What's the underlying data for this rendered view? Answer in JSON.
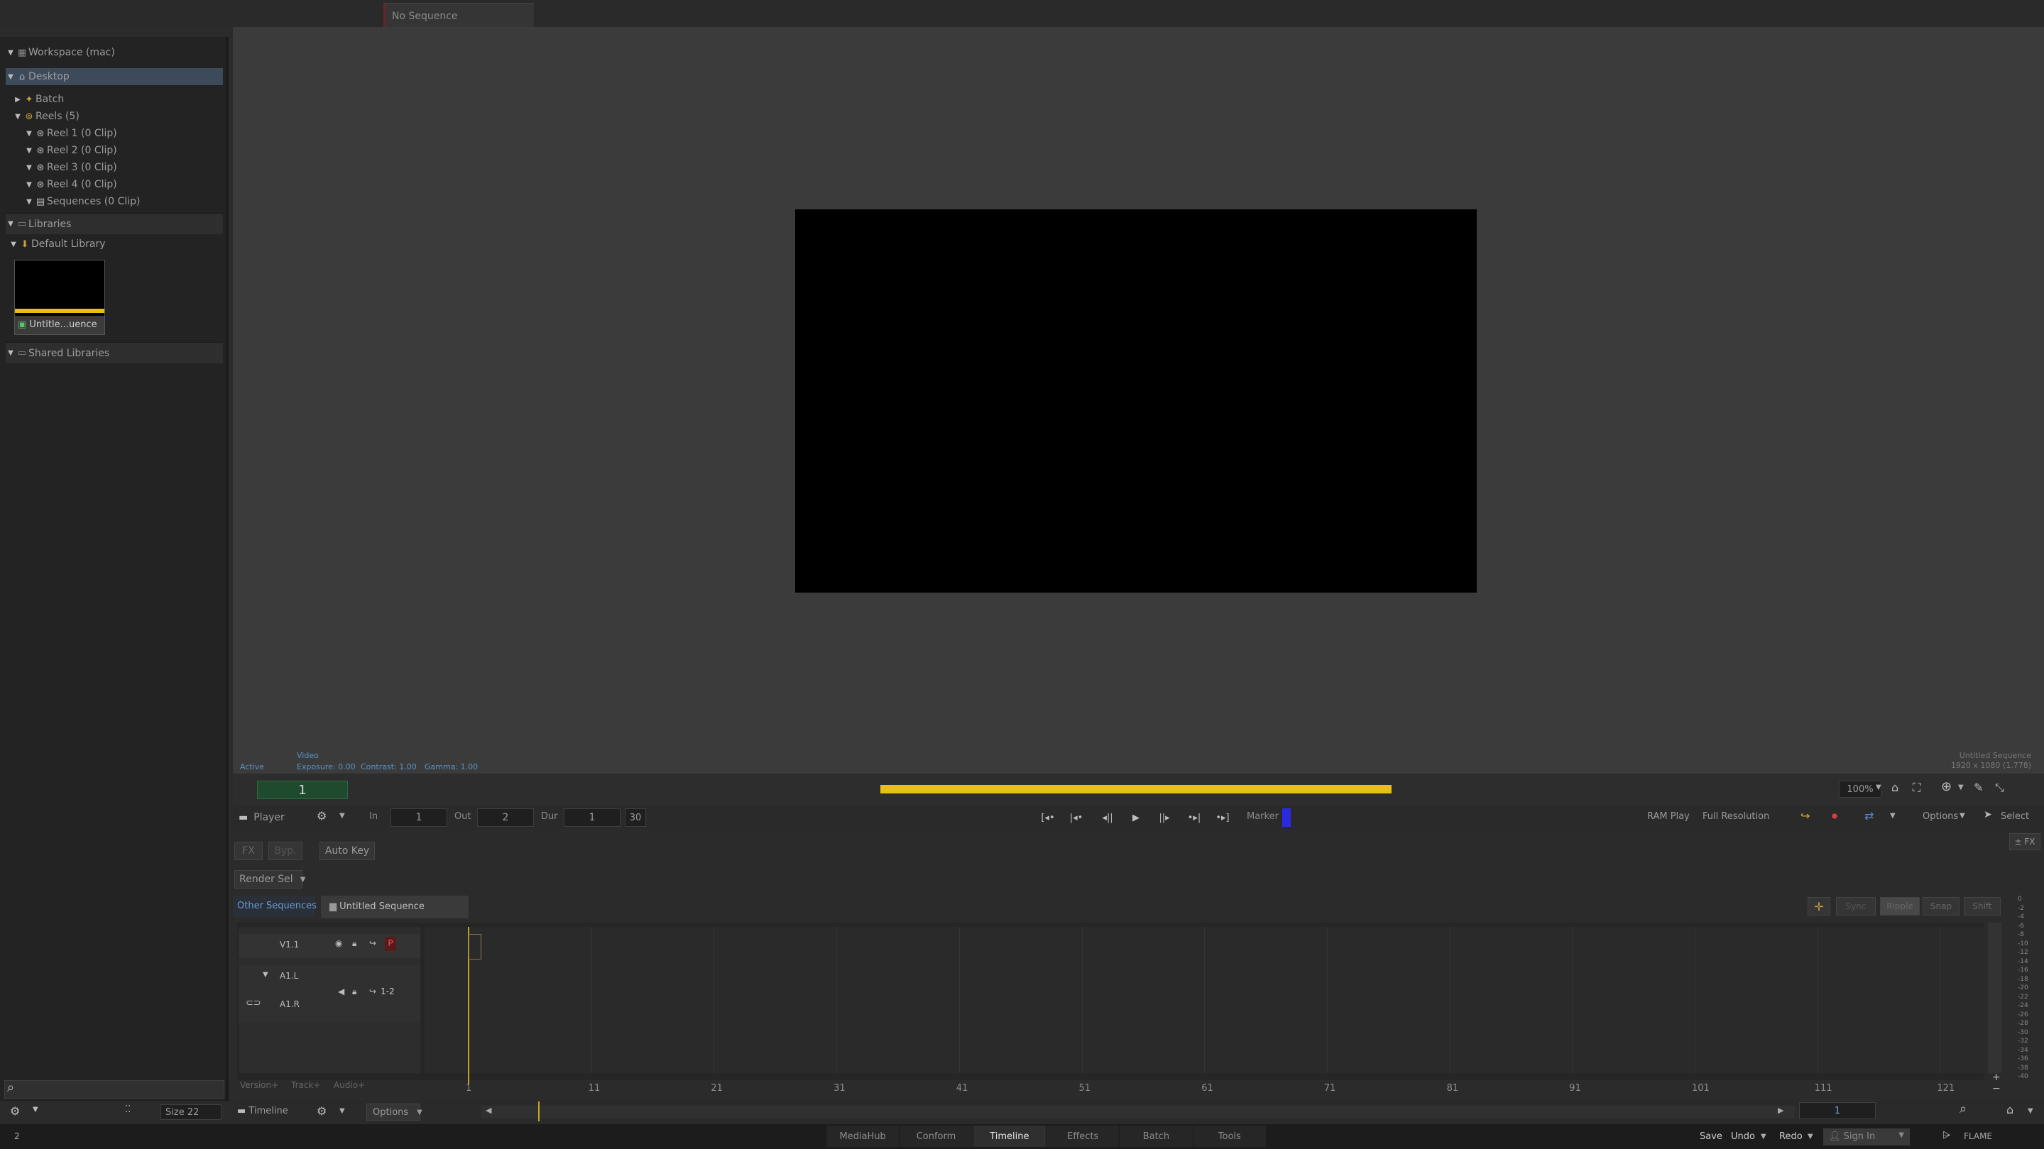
{
  "window": {
    "tab_label": "No Sequence"
  },
  "sidebar": {
    "workspace": "Workspace (mac)",
    "desktop": "Desktop",
    "batch": "Batch",
    "reels": "Reels (5)",
    "reel_items": [
      "Reel 1 (0 Clip)",
      "Reel 2 (0 Clip)",
      "Reel 3 (0 Clip)",
      "Reel 4 (0 Clip)",
      "Sequences (0 Clip)"
    ],
    "libraries": "Libraries",
    "default_library": "Default Library",
    "clip_thumb_label": "Untitle...uence",
    "shared_libraries": "Shared Libraries",
    "size_label": "Size 22"
  },
  "viewer": {
    "active_label": "Active",
    "video_label": "Video",
    "exposure": "Exposure: 0.00",
    "contrast": "Contrast: 1.00",
    "gamma": "Gamma: 1.00",
    "seq_name": "Untitled Sequence",
    "seq_res": "1920 x 1080 (1.778)",
    "frame_counter": "1",
    "zoom": "100%"
  },
  "player_bar": {
    "player_label": "Player",
    "in_label": "In",
    "in_value": "1",
    "out_label": "Out",
    "out_value": "2",
    "dur_label": "Dur",
    "dur_value": "1",
    "fps": "30",
    "marker_label": "Marker",
    "ram_play": "RAM Play",
    "full_res": "Full Resolution",
    "options": "Options",
    "select": "Select",
    "marker_color": "#2a2ae0"
  },
  "tools": {
    "fx": "FX",
    "bypass": "Byp.",
    "auto_key": "Auto Key",
    "render_sel": "Render Sel",
    "fx_right": "± FX"
  },
  "sequence_tabs": {
    "other": "Other Sequences",
    "current": "Untitled Sequence"
  },
  "timeline_toggles": [
    "Sync",
    "Ripple",
    "Snap",
    "Shift"
  ],
  "tracks": {
    "v1": "V1.1",
    "p_badge": "P",
    "a1l": "A1.L",
    "a1r": "A1.R",
    "a_pair": "1-2"
  },
  "footer": {
    "version": "Version+",
    "track": "Track+",
    "audio": "Audio+",
    "timeline_label": "Timeline",
    "options": "Options",
    "frame_field": "1"
  },
  "ruler": [
    "1",
    "11",
    "21",
    "31",
    "41",
    "51",
    "61",
    "71",
    "81",
    "91",
    "101",
    "111",
    "121"
  ],
  "db_scale": [
    "0",
    "-2",
    "-4",
    "-6",
    "-8",
    "-10",
    "-12",
    "-14",
    "-16",
    "-18",
    "-20",
    "-22",
    "-24",
    "-26",
    "-28",
    "-30",
    "-32",
    "-34",
    "-36",
    "-38",
    "-40"
  ],
  "bottom_nav": [
    "MediaHub",
    "Conform",
    "Timeline",
    "Effects",
    "Batch",
    "Tools"
  ],
  "status": {
    "left_num": "2",
    "save": "Save",
    "undo": "Undo",
    "redo": "Redo",
    "sign_in": "Sign In",
    "brand": "FLAME"
  },
  "colors": {
    "accent_yellow": "#e7c012",
    "green_counter": "#1f4a2e",
    "select_blue": "#3d4a5a"
  }
}
